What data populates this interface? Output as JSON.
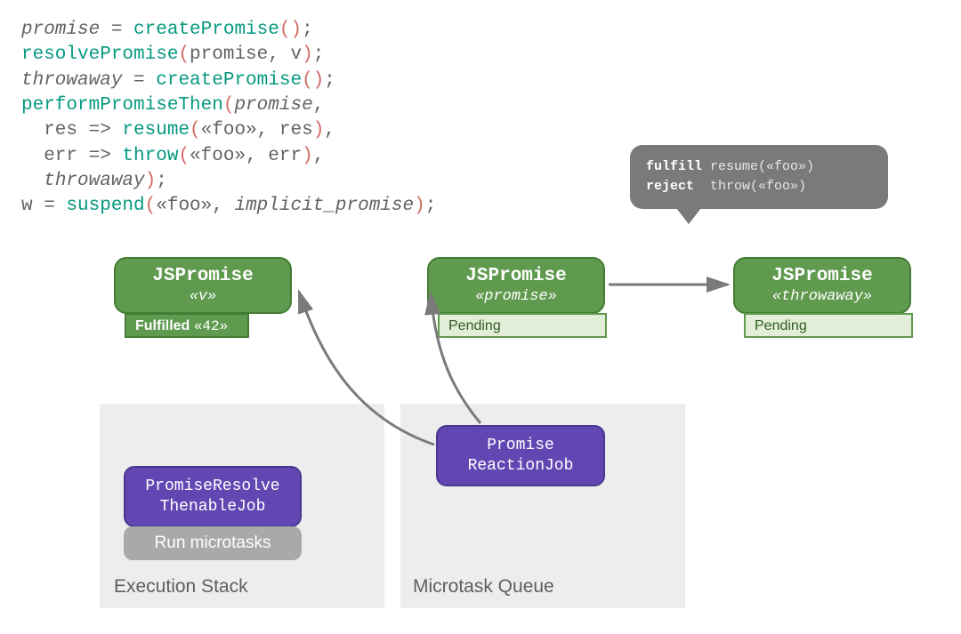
{
  "code": {
    "l1a": "promise",
    "l1b": " = ",
    "l1c": "createPromise",
    "l1d": "()",
    "l1e": ";",
    "l2a": "resolvePromise",
    "l2b": "(",
    "l2c": "promise, v",
    "l2d": ")",
    "l2e": ";",
    "l3a": "throwaway",
    "l3b": " = ",
    "l3c": "createPromise",
    "l3d": "()",
    "l3e": ";",
    "l4a": "performPromiseThen",
    "l4b": "(",
    "l4c": "promise",
    "l4d": ",",
    "l5a": "  res => ",
    "l5b": "resume",
    "l5c": "(",
    "l5d": "«foo», res",
    "l5e": ")",
    "l5f": ",",
    "l6a": "  err => ",
    "l6b": "throw",
    "l6c": "(",
    "l6d": "«foo», err",
    "l6e": ")",
    "l6f": ",",
    "l7a": "  ",
    "l7b": "throwaway",
    "l7c": ")",
    "l7d": ";",
    "l8a": "w = ",
    "l8b": "suspend",
    "l8c": "(",
    "l8d": "«foo», ",
    "l8e": "implicit_promise",
    "l8f": ")",
    "l8g": ";"
  },
  "boxes": {
    "p1": {
      "title": "JSPromise",
      "sub": "«v»",
      "status_label": "Fulfilled ",
      "status_val": "«42»"
    },
    "p2": {
      "title": "JSPromise",
      "sub": "«promise»",
      "status": "Pending"
    },
    "p3": {
      "title": "JSPromise",
      "sub": "«throwaway»",
      "status": "Pending"
    }
  },
  "bubble": {
    "l1a": "fulfill",
    "l1b": " resume(«foo»)",
    "l2a": "reject",
    "l2b": "  throw(«foo»)"
  },
  "stacks": {
    "exec_label": "Execution Stack",
    "micro_label": "Microtask Queue",
    "job1": "PromiseResolve\nThenableJob",
    "job2": "Promise\nReactionJob",
    "run": "Run microtasks"
  }
}
